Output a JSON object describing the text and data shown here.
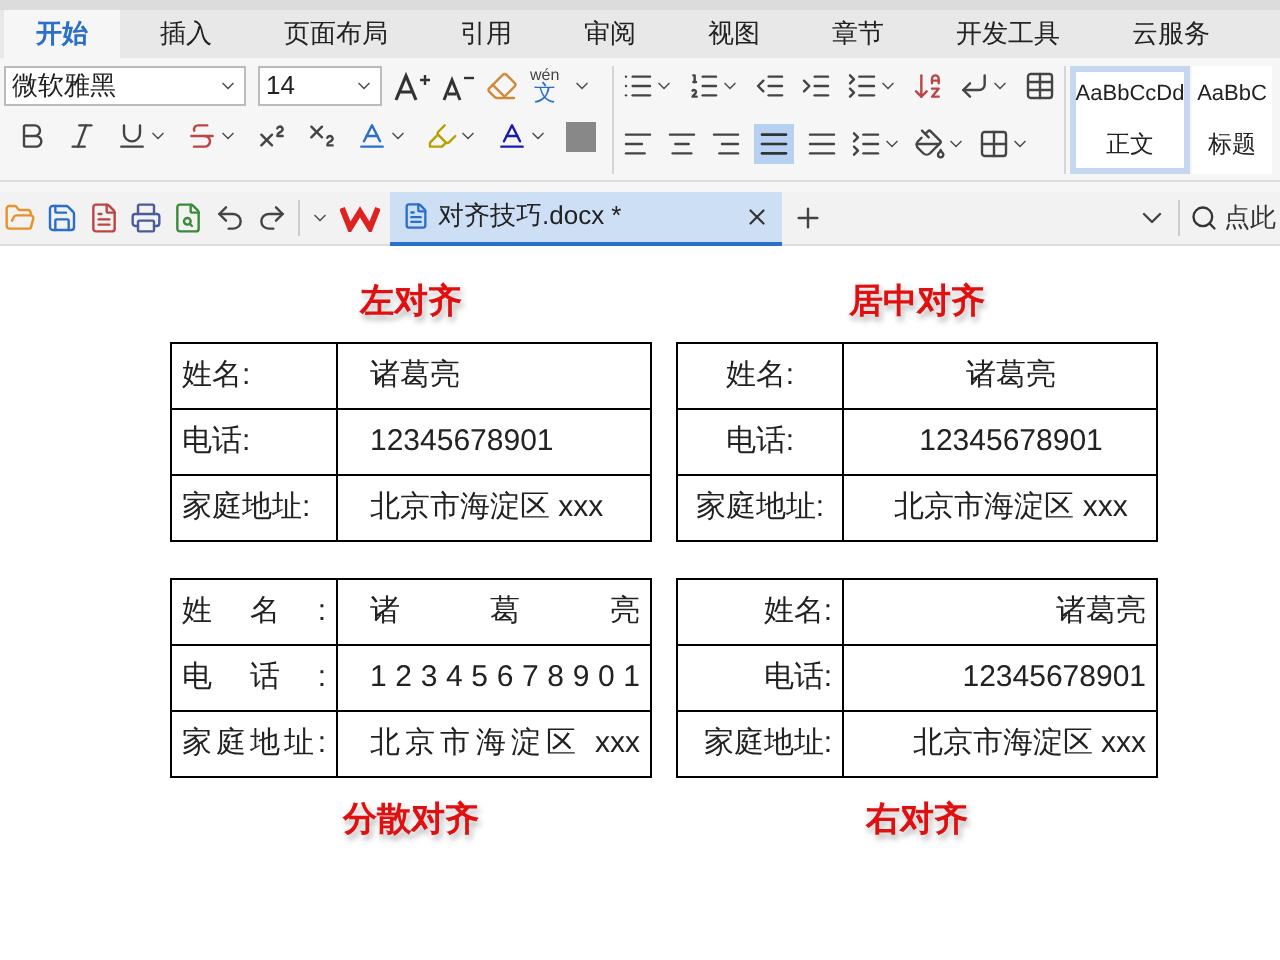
{
  "menu_tabs": [
    {
      "label": "开始",
      "selected": true
    },
    {
      "label": "插入",
      "selected": false
    },
    {
      "label": "页面布局",
      "selected": false
    },
    {
      "label": "引用",
      "selected": false
    },
    {
      "label": "审阅",
      "selected": false
    },
    {
      "label": "视图",
      "selected": false
    },
    {
      "label": "章节",
      "selected": false
    },
    {
      "label": "开发工具",
      "selected": false
    },
    {
      "label": "云服务",
      "selected": false
    }
  ],
  "ribbon": {
    "font_name": "微软雅黑",
    "font_size": "14",
    "phonetic_top": "wén",
    "phonetic_bottom": "文",
    "styles": [
      {
        "preview": "AaBbCcDd",
        "label": "正文",
        "selected": true
      },
      {
        "preview": "AaBbC",
        "label": "标题",
        "selected": false
      }
    ]
  },
  "quick_bar": {
    "document_tab": {
      "title": "对齐技巧.docx *",
      "selected": true
    },
    "search_placeholder": "点此"
  },
  "examples": [
    {
      "title": "左对齐",
      "kind": "left",
      "rows": [
        [
          "姓名:",
          "诸葛亮"
        ],
        [
          "电话:",
          "12345678901"
        ],
        [
          "家庭地址:",
          "北京市海淀区 xxx"
        ]
      ]
    },
    {
      "title": "居中对齐",
      "kind": "center",
      "rows": [
        [
          "姓名:",
          "诸葛亮"
        ],
        [
          "电话:",
          "12345678901"
        ],
        [
          "家庭地址:",
          "北京市海淀区 xxx"
        ]
      ]
    },
    {
      "title": "分散对齐",
      "kind": "distribute",
      "rows": [
        [
          "姓 名 :",
          "诸 葛 亮"
        ],
        [
          "电 话 :",
          "1 2 3 4 5 6 7 8 9 0 1"
        ],
        [
          "家庭地址:",
          "北京市海淀区 xxx"
        ]
      ]
    },
    {
      "title": "右对齐",
      "kind": "right",
      "rows": [
        [
          "姓名:",
          "诸葛亮"
        ],
        [
          "电话:",
          "12345678901"
        ],
        [
          "家庭地址:",
          "北京市海淀区 xxx"
        ]
      ]
    }
  ]
}
